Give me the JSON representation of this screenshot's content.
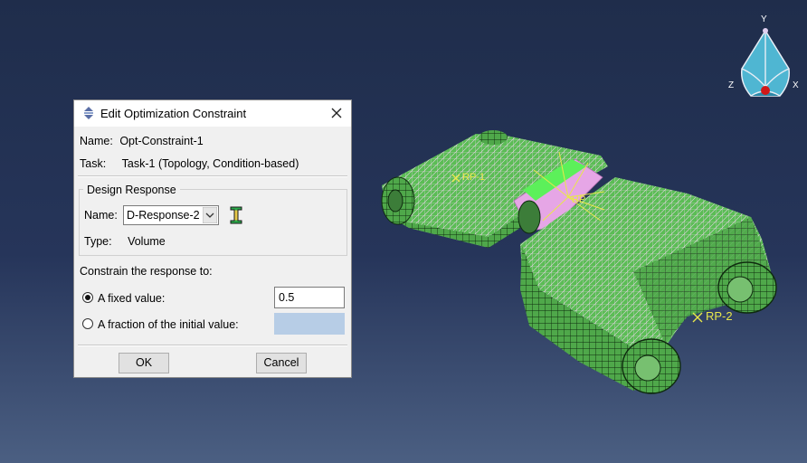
{
  "viewport": {
    "rp1_label": "RP-1",
    "rp2_label": "RP-2",
    "rp_center_label": "RP",
    "axis_y": "Y",
    "axis_z": "Z",
    "axis_x": "X"
  },
  "dialog": {
    "title": "Edit Optimization Constraint",
    "name_label": "Name:",
    "name_value": "Opt-Constraint-1",
    "task_label": "Task:",
    "task_value": "Task-1 (Topology, Condition-based)",
    "design_response": {
      "group_title": "Design Response",
      "name_label": "Name:",
      "selected": "D-Response-2",
      "type_label": "Type:",
      "type_value": "Volume"
    },
    "constrain_label": "Constrain the response to:",
    "options": [
      {
        "label": "A fixed value:",
        "value": "0.5",
        "selected": true
      },
      {
        "label": "A fraction of the initial value:",
        "value": "",
        "selected": false
      }
    ],
    "ok_label": "OK",
    "cancel_label": "Cancel"
  },
  "colors": {
    "mesh_green": "#4fa84a",
    "mesh_highlight": "#63e05a",
    "selection_pink": "#e6a6e6",
    "rp_yellow": "#e8e84a"
  }
}
